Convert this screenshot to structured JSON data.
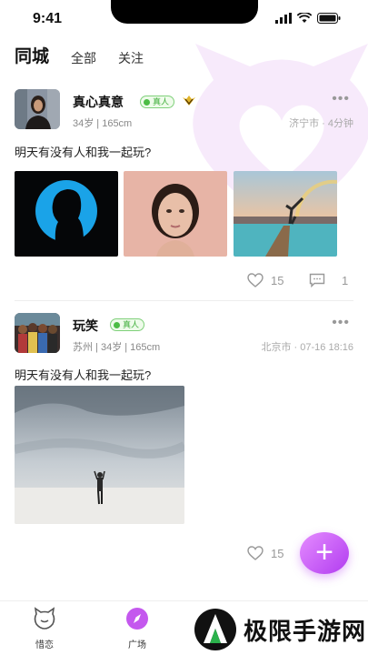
{
  "status": {
    "time": "9:41"
  },
  "tabs": [
    {
      "label": "同城",
      "active": true
    },
    {
      "label": "全部",
      "active": false
    },
    {
      "label": "关注",
      "active": false
    }
  ],
  "posts": [
    {
      "name": "真心真意",
      "badge": "真人",
      "vip": true,
      "meta": "34岁 | 165cm",
      "location_time": "济宁市 · 4分钟",
      "text": "明天有没有人和我一起玩?",
      "likes": "15",
      "comments": "1"
    },
    {
      "name": "玩笑",
      "badge": "真人",
      "vip": false,
      "meta": "苏州 | 34岁 | 165cm",
      "location_time": "北京市 · 07-16 18:16",
      "text": "明天有没有人和我一起玩?",
      "likes": "15"
    }
  ],
  "fab": {
    "label": "+"
  },
  "bottom_nav": [
    {
      "label": "惜恋",
      "icon": "cat-face-icon"
    },
    {
      "label": "广场",
      "icon": "compass-icon"
    }
  ],
  "watermark": {
    "text": "极限手游网"
  },
  "colors": {
    "accent": "#b13cf0",
    "badge_green": "#3fae3a",
    "vip_gold": "#e2b52a"
  }
}
